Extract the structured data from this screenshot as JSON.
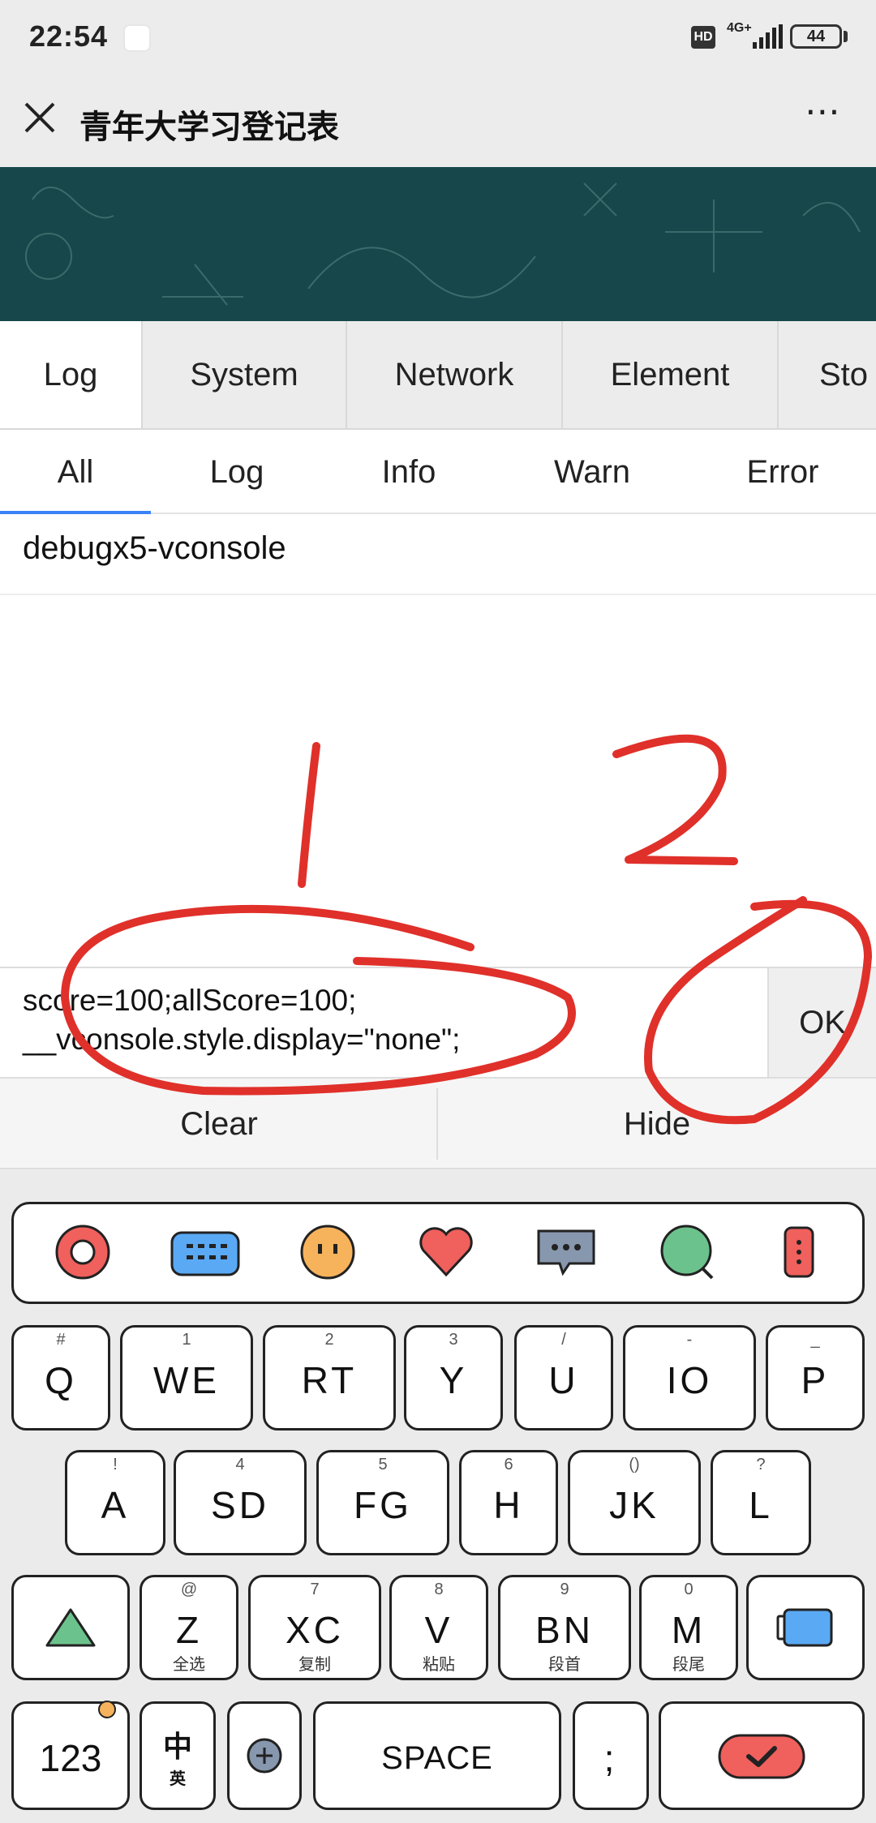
{
  "status_bar": {
    "time": "22:54",
    "hd": "HD",
    "network": "4G+",
    "battery": "44"
  },
  "title_bar": {
    "title": "青年大学习登记表",
    "more": "⋯"
  },
  "vconsole": {
    "tabs": [
      "Log",
      "System",
      "Network",
      "Element",
      "Sto"
    ],
    "subtabs": [
      "All",
      "Log",
      "Info",
      "Warn",
      "Error"
    ],
    "log_lines": [
      "debugx5-vconsole"
    ],
    "command_line1": "score=100;allScore=100;",
    "command_line2": "__vconsole.style.display=\"none\";",
    "ok_label": "OK",
    "clear_label": "Clear",
    "hide_label": "Hide"
  },
  "annotations": {
    "mark1": "1",
    "mark2": "2",
    "color": "#e0302a"
  },
  "keyboard": {
    "row1": [
      {
        "main": "Q",
        "sup": "#"
      },
      {
        "main": "WE",
        "sup": "1"
      },
      {
        "main": "RT",
        "sup": "2"
      },
      {
        "main": "Y",
        "sup": "3"
      },
      {
        "main": "U",
        "sup": "/"
      },
      {
        "main": "IO",
        "sup": "-"
      },
      {
        "main": "P",
        "sup": "_"
      }
    ],
    "row2": [
      {
        "main": "A",
        "sup": "!"
      },
      {
        "main": "SD",
        "sup": "4"
      },
      {
        "main": "FG",
        "sup": "5"
      },
      {
        "main": "H",
        "sup": "6"
      },
      {
        "main": "JK",
        "sup": "()"
      },
      {
        "main": "L",
        "sup": "?"
      }
    ],
    "row3": [
      {
        "main": "Z",
        "sup": "@",
        "sub": "全选"
      },
      {
        "main": "XC",
        "sup": "7",
        "sub": "复制"
      },
      {
        "main": "V",
        "sup": "8",
        "sub": "粘贴"
      },
      {
        "main": "BN",
        "sup": "9",
        "sub": "段首"
      },
      {
        "main": "M",
        "sup": "0",
        "sub": "段尾"
      }
    ],
    "numbers_label": "123",
    "lang_main": "中",
    "lang_sub": "英",
    "space_label": "SPACE",
    "punct_label": ";"
  }
}
